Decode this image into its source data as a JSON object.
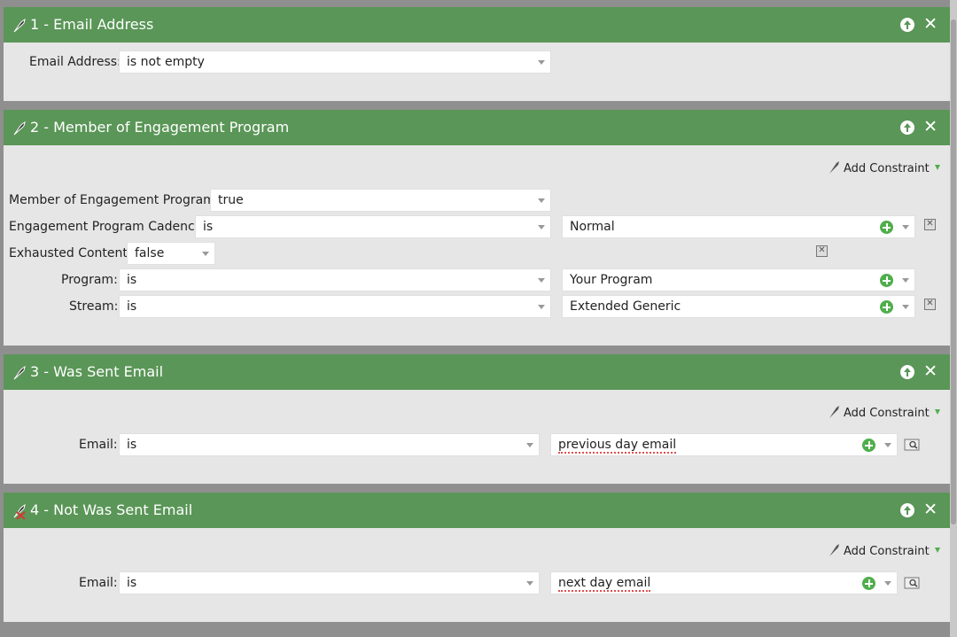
{
  "filters": [
    {
      "title": "1 - Email Address",
      "rows": [
        {
          "label": "Email Address:",
          "operator": "is not empty"
        }
      ]
    },
    {
      "title": "2 - Member of Engagement Program",
      "add_constraint": "Add Constraint",
      "rows": [
        {
          "label": "Member of Engagement Program:",
          "operator": "true"
        },
        {
          "label": "Engagement Program Cadence:",
          "operator": "is",
          "value": "Normal"
        },
        {
          "label": "Exhausted Content:",
          "operator": "false"
        },
        {
          "label": "Program:",
          "operator": "is",
          "value": "Your Program"
        },
        {
          "label": "Stream:",
          "operator": "is",
          "value": "Extended Generic"
        }
      ]
    },
    {
      "title": "3 - Was Sent Email",
      "add_constraint": "Add Constraint",
      "rows": [
        {
          "label": "Email:",
          "operator": "is",
          "value": "previous day email"
        }
      ]
    },
    {
      "title": "4 - Not Was Sent Email",
      "add_constraint": "Add Constraint",
      "rows": [
        {
          "label": "Email:",
          "operator": "is",
          "value": "next day email"
        }
      ]
    }
  ],
  "icons": {
    "header_tool": "wrench-icon",
    "header_not_tool": "wrench-not-icon",
    "move_up": "move-up-icon",
    "close": "close-icon",
    "add_value": "plus-circle-icon",
    "remove": "remove-x-icon",
    "lookup": "search-lookup-icon"
  },
  "colors": {
    "header_green": "#5a9657",
    "panel_bg": "#e6e6e6",
    "page_bg": "#8f8f8f",
    "plus_green": "#4fae4c"
  }
}
